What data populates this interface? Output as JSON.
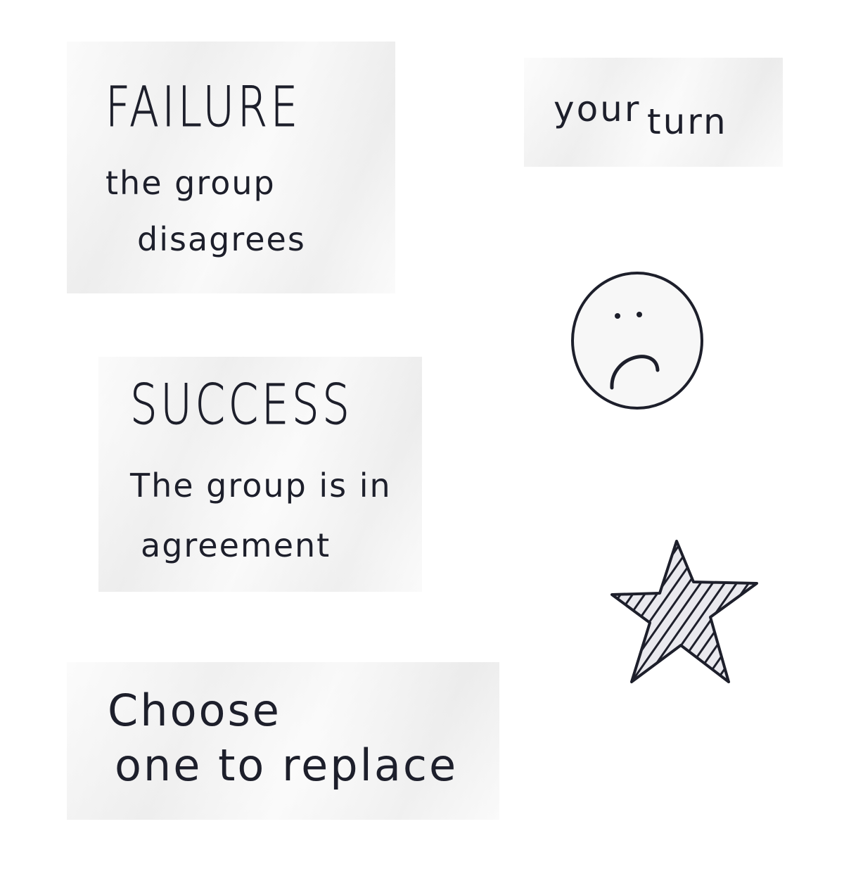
{
  "cards": {
    "failure": {
      "title": "FAILURE",
      "line1": "the group",
      "line2": "disagrees"
    },
    "your_turn": {
      "word1": "your",
      "word2": "turn"
    },
    "success": {
      "title": "SUCCESS",
      "line1": "The group is in",
      "line2": "agreement"
    },
    "choose": {
      "line1": "Choose",
      "line2": "one to replace"
    }
  },
  "icons": {
    "sad_face": "sad-face-icon",
    "star": "star-icon"
  },
  "colors": {
    "ink": "#1d1f2b",
    "paper": "#f4f4f4",
    "background": "#ffffff"
  }
}
